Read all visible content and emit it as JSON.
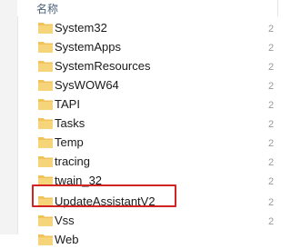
{
  "column_header": {
    "name_label": "名称"
  },
  "folders": [
    {
      "name": "System32"
    },
    {
      "name": "SystemApps"
    },
    {
      "name": "SystemResources"
    },
    {
      "name": "SysWOW64"
    },
    {
      "name": "TAPI"
    },
    {
      "name": "Tasks"
    },
    {
      "name": "Temp"
    },
    {
      "name": "tracing"
    },
    {
      "name": "twain_32"
    },
    {
      "name": "UpdateAssistantV2",
      "highlighted": true
    },
    {
      "name": "Vss"
    },
    {
      "name": "Web"
    }
  ],
  "next_column_glyph": "2",
  "colors": {
    "folder": "#f0c35a",
    "highlight_border": "#d32424"
  },
  "icon": "folder-icon"
}
